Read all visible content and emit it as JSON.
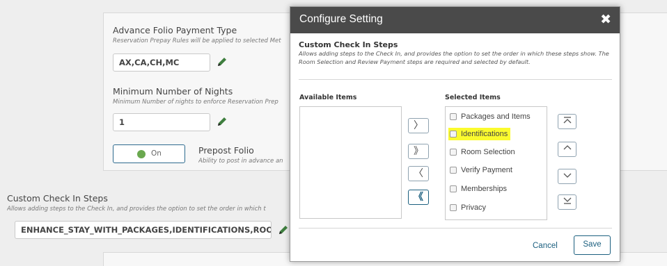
{
  "background": {
    "advance_folio": {
      "title": "Advance Folio Payment Type",
      "desc": "Reservation Prepay Rules will be applied to selected Met",
      "value": "AX,CA,CH,MC"
    },
    "min_nights": {
      "title": "Minimum Number of Nights",
      "desc": "Minimum Number of nights to enforce Reservation Prep",
      "value": "1"
    },
    "prepost": {
      "toggle_label": "On",
      "title": "Prepost Folio",
      "desc": "Ability to post in advance an"
    },
    "custom_check_in": {
      "title": "Custom Check In Steps",
      "desc": "Allows adding steps to the Check In, and provides the option to set the order in which t",
      "value": "ENHANCE_STAY_WITH_PACKAGES,IDENTIFICATIONS,ROOM..."
    }
  },
  "dialog": {
    "title": "Configure Setting",
    "close_icon": "✖",
    "section_title": "Custom Check In Steps",
    "section_desc": "Allows adding steps to the Check In, and provides the option to set the order in which these steps show. The Room Selection and Review Payment steps are required and selected by default.",
    "available_label": "Available Items",
    "selected_label": "Selected Items",
    "available_items": [],
    "selected_items": [
      {
        "label": "Packages and Items",
        "checked": false
      },
      {
        "label": "Identifications",
        "checked": false,
        "highlighted": true
      },
      {
        "label": "Room Selection",
        "checked": false
      },
      {
        "label": "Verify Payment",
        "checked": false
      },
      {
        "label": "Memberships",
        "checked": false
      },
      {
        "label": "Privacy",
        "checked": false
      }
    ],
    "move_buttons": {
      "move_right": "〉",
      "move_all_right": "》",
      "move_left": "〈",
      "move_all_left": "《"
    },
    "order_buttons": {
      "move_top": "⌅",
      "move_up": "︿",
      "move_down": "﹀",
      "move_bottom": "⌄"
    },
    "cancel_label": "Cancel",
    "save_label": "Save"
  },
  "colors": {
    "header_bg": "#4a4a4a",
    "accent": "#1b5f7f",
    "highlight": "#fbfb2e",
    "toggle_on": "#6aa84f"
  }
}
